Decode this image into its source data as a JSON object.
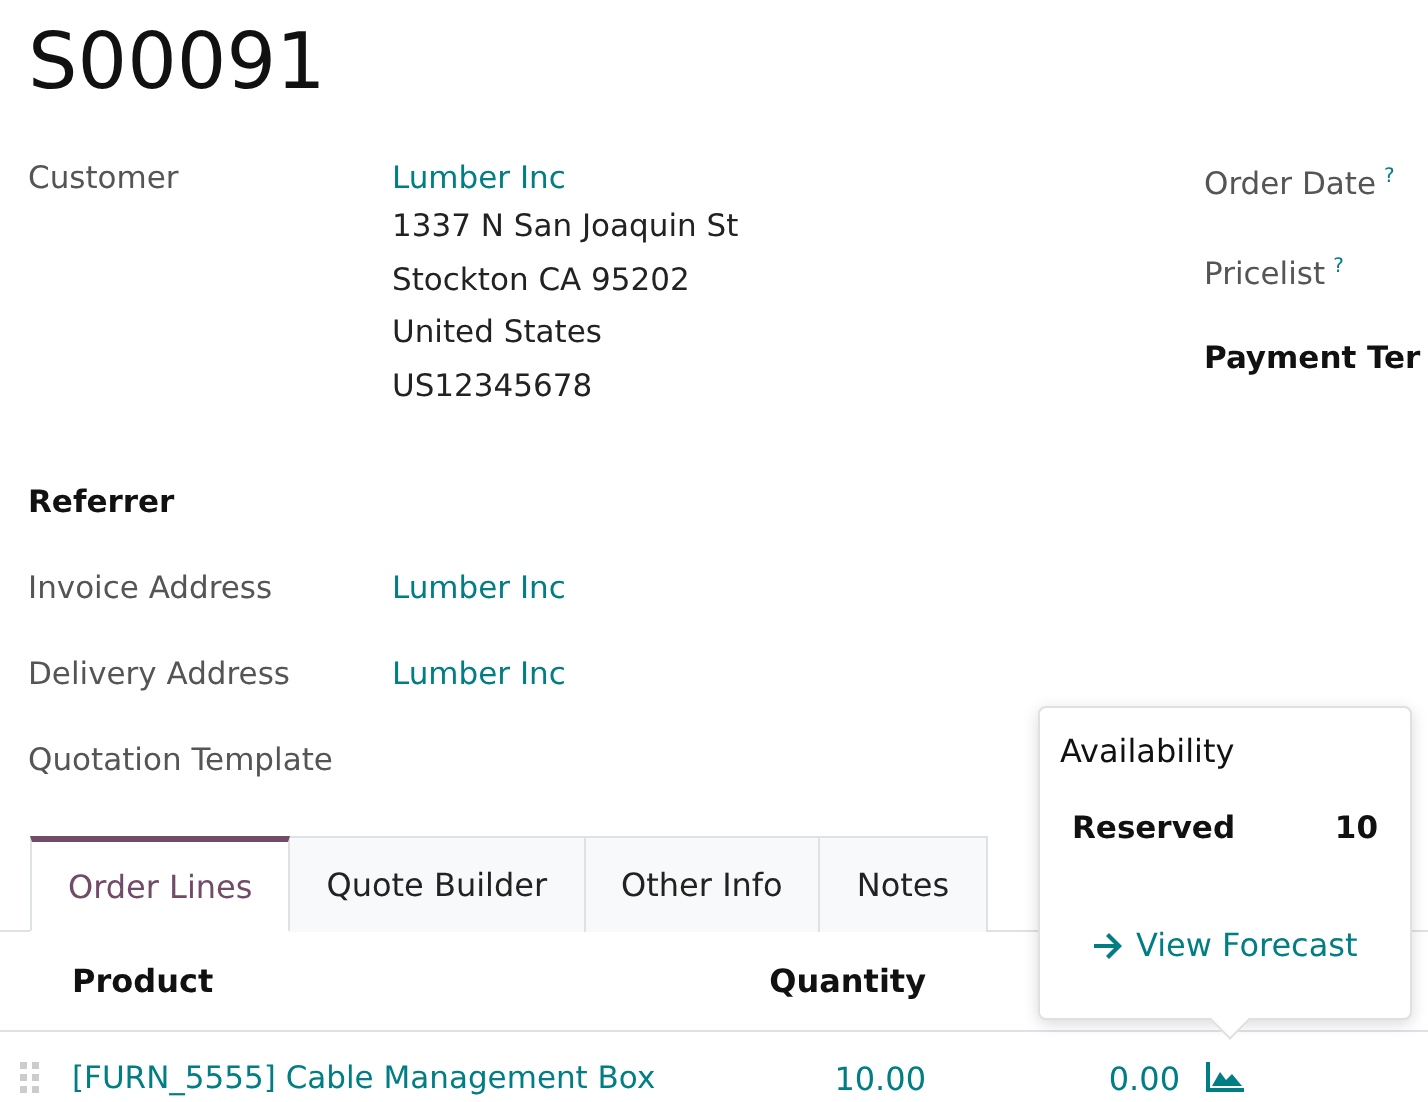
{
  "title": "S00091",
  "customer": {
    "label": "Customer",
    "name": "Lumber Inc",
    "address_lines": [
      "1337 N San Joaquin St",
      "Stockton CA 95202",
      "United States",
      "US12345678"
    ]
  },
  "referrer": {
    "label": "Referrer"
  },
  "fields": [
    {
      "label": "Invoice Address",
      "value": "Lumber Inc"
    },
    {
      "label": "Delivery Address",
      "value": "Lumber Inc"
    },
    {
      "label": "Quotation Template"
    }
  ],
  "side_fields": [
    {
      "label": "Order Date",
      "help": "?",
      "kind": "plain"
    },
    {
      "label": "Pricelist",
      "help": "?",
      "kind": "plain"
    },
    {
      "label": "Payment Ter",
      "kind": "bold"
    }
  ],
  "tabs": [
    {
      "label": "Order Lines",
      "selected": true
    },
    {
      "label": "Quote Builder",
      "selected": false
    },
    {
      "label": "Other Info",
      "selected": false
    },
    {
      "label": "Notes",
      "selected": false
    }
  ],
  "table": {
    "columns": [
      "Product",
      "Quantity"
    ],
    "rows": [
      {
        "product": "[FURN_5555] Cable Management Box",
        "quantity": "10.00",
        "column_3": "0.00"
      }
    ]
  },
  "popover": {
    "title": "Availability",
    "rows": [
      {
        "label": "Reserved",
        "value": "10"
      }
    ],
    "link": "View Forecast"
  }
}
